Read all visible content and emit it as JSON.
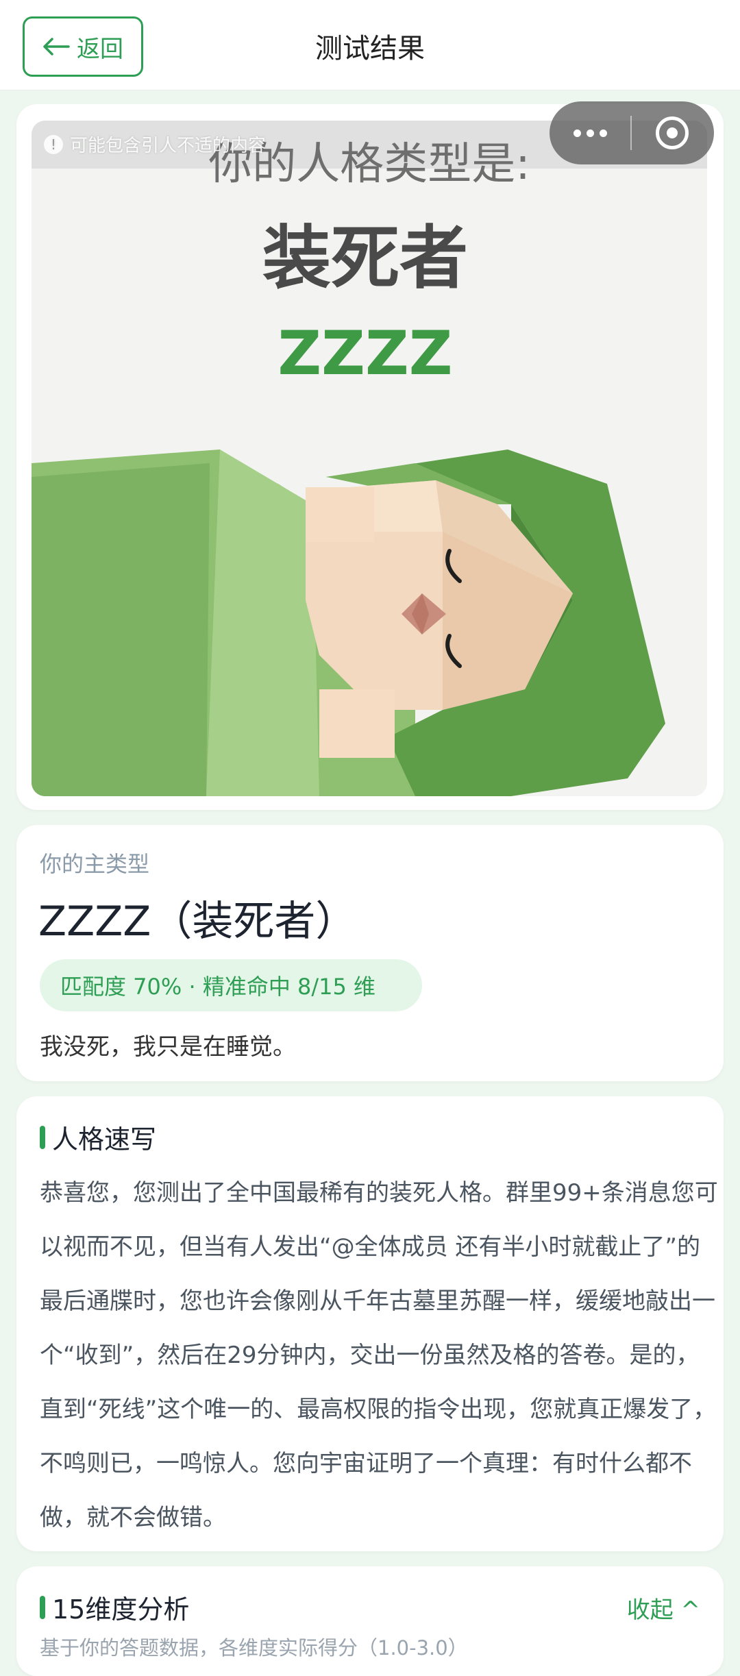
{
  "header": {
    "back_label": "返回",
    "title": "测试结果"
  },
  "result_image": {
    "content_warning": "可能包含引人不适的内容",
    "heading": "你的人格类型是:",
    "type_name": "装死者",
    "type_code": "ZZZZ"
  },
  "main_type": {
    "label": "你的主类型",
    "name": "ZZZZ（装死者）",
    "match": "匹配度 70% · 精准命中 8/15 维",
    "quote": "我没死，我只是在睡觉。"
  },
  "summary": {
    "title": "人格速写",
    "text": "恭喜您，您测出了全中国最稀有的装死人格。群里99+条消息您可以视而不见，但当有人发出“@全体成员 还有半小时就截止了”的最后通牒时，您也许会像刚从千年古墓里苏醒一样，缓缓地敲出一个“收到”，然后在29分钟内，交出一份虽然及格的答卷。是的，直到“死线”这个唯一的、最高权限的指令出现，您就真正爆发了，不鸣则已，一鸣惊人。您向宇宙证明了一个真理：有时什么都不做，就不会做错。"
  },
  "dimensions": {
    "title": "15维度分析",
    "collapse_label": "收起 ^",
    "subtitle": "基于你的答题数据，各维度实际得分（1.0-3.0）"
  },
  "colors": {
    "accent": "#2f9e55",
    "page_bg": "#eef7ef",
    "pill_bg": "#e4f6e8"
  },
  "icons": {
    "back": "arrow-left-icon",
    "more": "more-dots-icon",
    "close": "close-circle-icon",
    "warning": "info-icon"
  }
}
